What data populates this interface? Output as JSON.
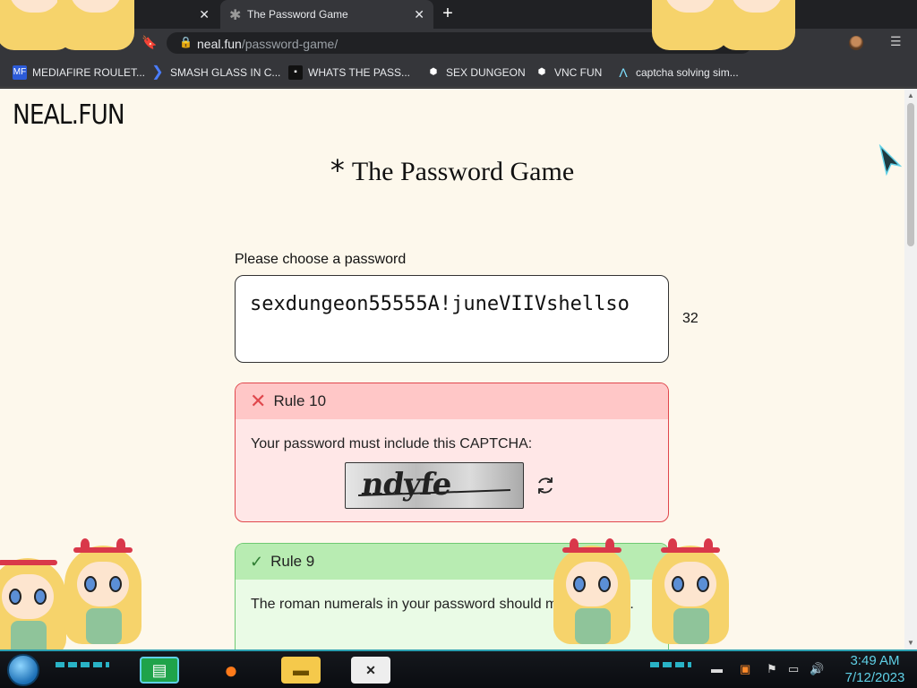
{
  "browser": {
    "tabs": [
      {
        "label": ""
      },
      {
        "label": "The Password Game",
        "active": true
      }
    ],
    "new_tab_label": "+",
    "url_host": "neal.fun",
    "url_path": "/password-game/",
    "bookmarks": [
      {
        "label": "MEDIAFIRE ROULET...",
        "icon": "mediafire-icon"
      },
      {
        "label": "SMASH GLASS IN C...",
        "icon": "glass-icon"
      },
      {
        "label": "WHATS THE PASS...",
        "icon": "dark-page-icon"
      },
      {
        "label": "SEX DUNGEON",
        "icon": "cube-icon"
      },
      {
        "label": "VNC FUN",
        "icon": "cube-icon"
      },
      {
        "label": "captcha solving sim...",
        "icon": "arrow-a-icon"
      }
    ]
  },
  "page": {
    "logo": "NEAL.FUN",
    "title_symbol": "*",
    "title": "The Password Game",
    "prompt": "Please choose a password",
    "password": "sexdungeon55555A!juneVIIVshellso",
    "char_count": "32",
    "rules": [
      {
        "status": "fail",
        "title": "Rule 10",
        "text": "Your password must include this CAPTCHA:",
        "captcha_text": "ndyfe"
      },
      {
        "status": "pass",
        "title": "Rule 9",
        "text": "The roman numerals in your password should multiply to 35."
      }
    ]
  },
  "taskbar": {
    "apps": [
      "chat-icon",
      "firefox-icon",
      "file-explorer-icon",
      "game-icon"
    ],
    "time": "3:49 AM",
    "date": "7/12/2023"
  },
  "colors": {
    "page_bg": "#fdf8ec",
    "fail_border": "#e0474c",
    "fail_header": "#ffc7c7",
    "pass_border": "#6fca72",
    "pass_header": "#b8ecb2",
    "taskbar_accent": "#2b9fb0"
  }
}
